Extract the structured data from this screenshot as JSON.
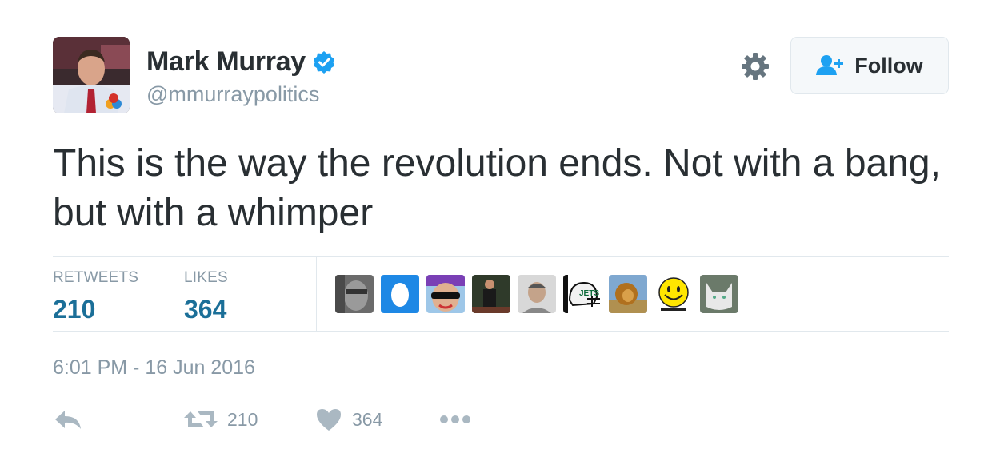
{
  "tweet": {
    "author": {
      "name": "Mark Murray",
      "handle": "@mmurraypolitics",
      "verified": true,
      "avatar_icon": "profile-photo"
    },
    "follow_button": {
      "label": "Follow",
      "icon": "follow-user-icon"
    },
    "settings_icon": "gear-icon",
    "text": "This is the way the revolution ends. Not with a bang, but with a whimper",
    "stats": {
      "retweets_label": "RETWEETS",
      "retweets_value": "210",
      "likes_label": "LIKES",
      "likes_value": "364"
    },
    "likers_count": 9,
    "timestamp": "6:01 PM - 16 Jun 2016",
    "actions": {
      "reply_icon": "reply-icon",
      "retweet_icon": "retweet-icon",
      "retweet_count": "210",
      "like_icon": "heart-icon",
      "like_count": "364",
      "more_icon": "more-dots-icon"
    }
  },
  "colors": {
    "text": "#292f33",
    "muted": "#8899a6",
    "stat_value": "#1b6f98",
    "verified": "#1da1f2",
    "follow_icon": "#1da1f2",
    "border": "#e1e8ed"
  }
}
